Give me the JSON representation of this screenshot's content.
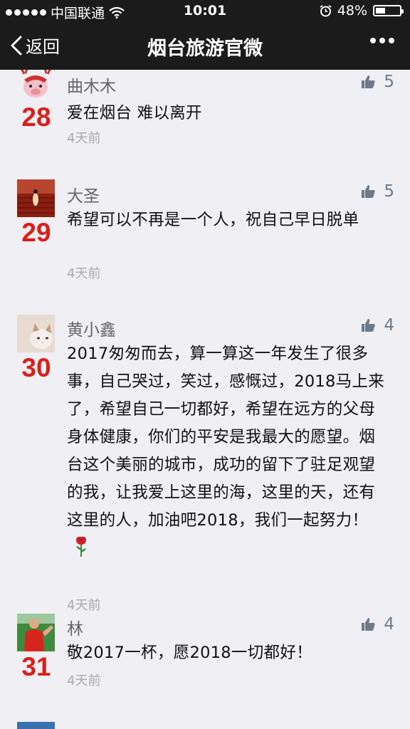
{
  "status": {
    "carrier": "中国联通",
    "time": "10:01",
    "battery": "48%",
    "battery_level": 0.48
  },
  "nav": {
    "back_label": "返回",
    "title": "烟台旅游官微"
  },
  "comments": [
    {
      "rank": "28",
      "name": "曲木木",
      "likes": "5",
      "text": "爱在烟台  难以离开",
      "time": "4天前"
    },
    {
      "rank": "29",
      "name": "大圣",
      "likes": "5",
      "text": "希望可以不再是一个人，祝自己早日脱单",
      "time": "4天前"
    },
    {
      "rank": "30",
      "name": "黄小鑫",
      "likes": "4",
      "text": "2017匆匆而去，算一算这一年发生了很多事，自己哭过，笑过，感慨过，2018马上来了，希望自己一切都好，希望在远方的父母身体健康，你们的平安是我最大的愿望。烟台这个美丽的城市，成功的留下了驻足观望的我，让我爱上这里的海，这里的天，还有这里的人，加油吧2018，我们一起努力！",
      "time": "4天前"
    },
    {
      "rank": "31",
      "name": "林",
      "likes": "4",
      "text": "敬2017一杯，愿2018一切都好！",
      "time": "4天前"
    }
  ],
  "icons": {
    "like": "thumbs-up-icon",
    "emoji": "rose-icon",
    "back": "chevron-left-icon",
    "more": "more-dots-icon"
  }
}
